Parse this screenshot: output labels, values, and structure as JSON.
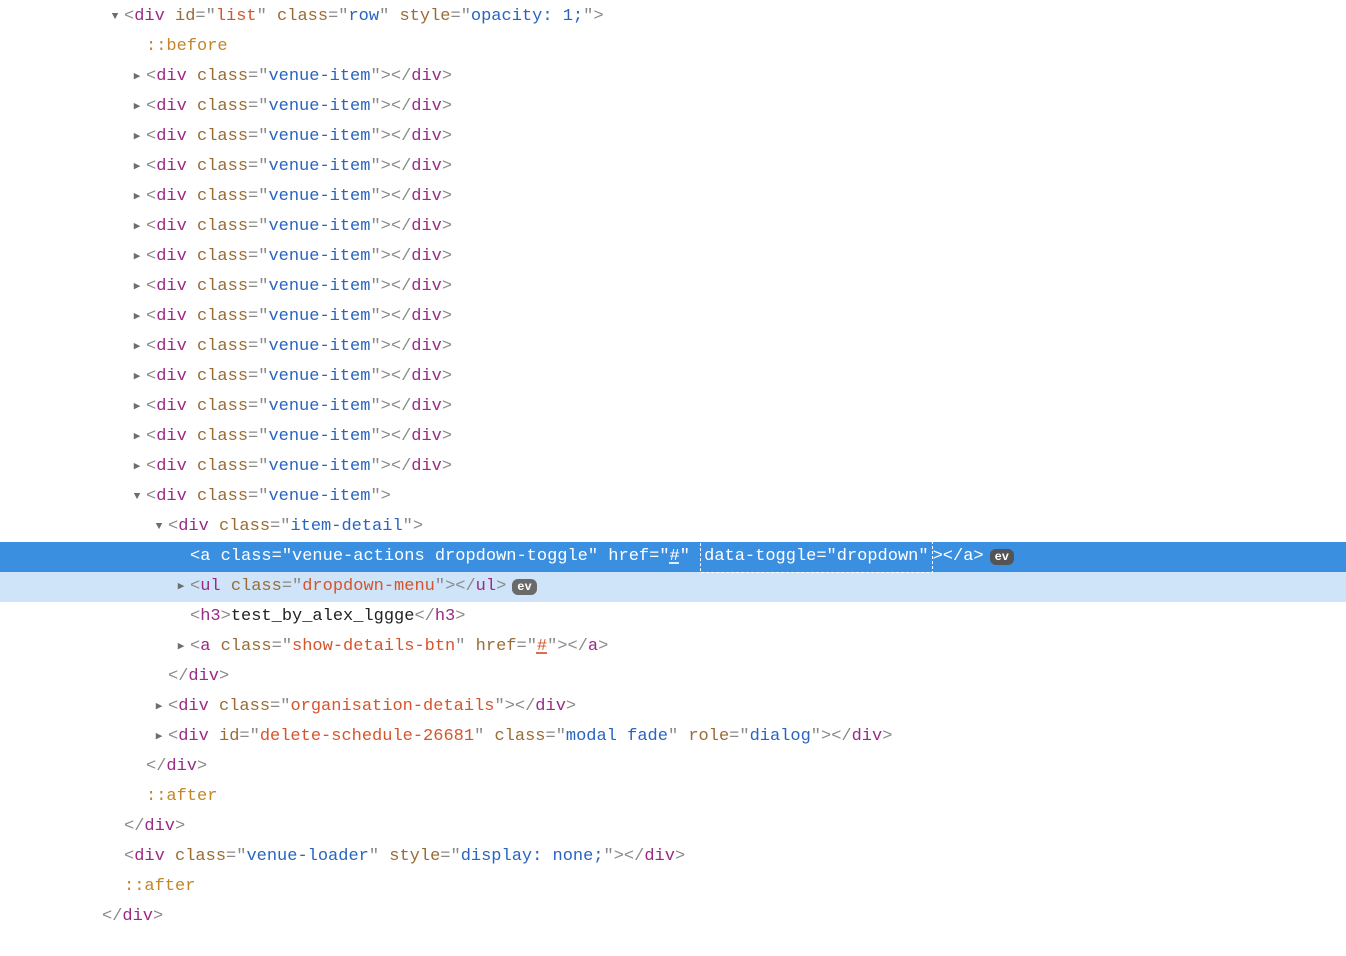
{
  "glyphs": {
    "down": "▼",
    "right": "▶",
    "ev": "ev"
  },
  "tokens": {
    "lt": "<",
    "gt": ">",
    "slash": "/",
    "eq": "=",
    "q": "\"",
    "div": "div",
    "a": "a",
    "ul": "ul",
    "h3": "h3",
    "id": "id",
    "class": "class",
    "style": "style",
    "href": "href",
    "role": "role",
    "data_toggle": "data-toggle"
  },
  "values": {
    "list_id": "list",
    "row_class": "row",
    "opacity_style": "opacity: 1;",
    "before": "::before",
    "after": "::after",
    "venue_item": "venue-item",
    "item_detail": "item-detail",
    "venue_actions": "venue-actions dropdown-toggle",
    "hash": "#",
    "dropdown": "dropdown",
    "dropdown_menu": "dropdown-menu",
    "h3_text": "test_by_alex_lggge",
    "show_details": "show-details-btn",
    "org_details": "organisation-details",
    "delete_id": "delete-schedule-26681",
    "modal_fade": "modal fade",
    "dialog": "dialog",
    "venue_loader": "venue-loader",
    "display_none": "display: none;"
  },
  "indents": {
    "l0": 108,
    "l1": 130,
    "l2": 152,
    "l3": 174
  },
  "venue_item_count": 14
}
